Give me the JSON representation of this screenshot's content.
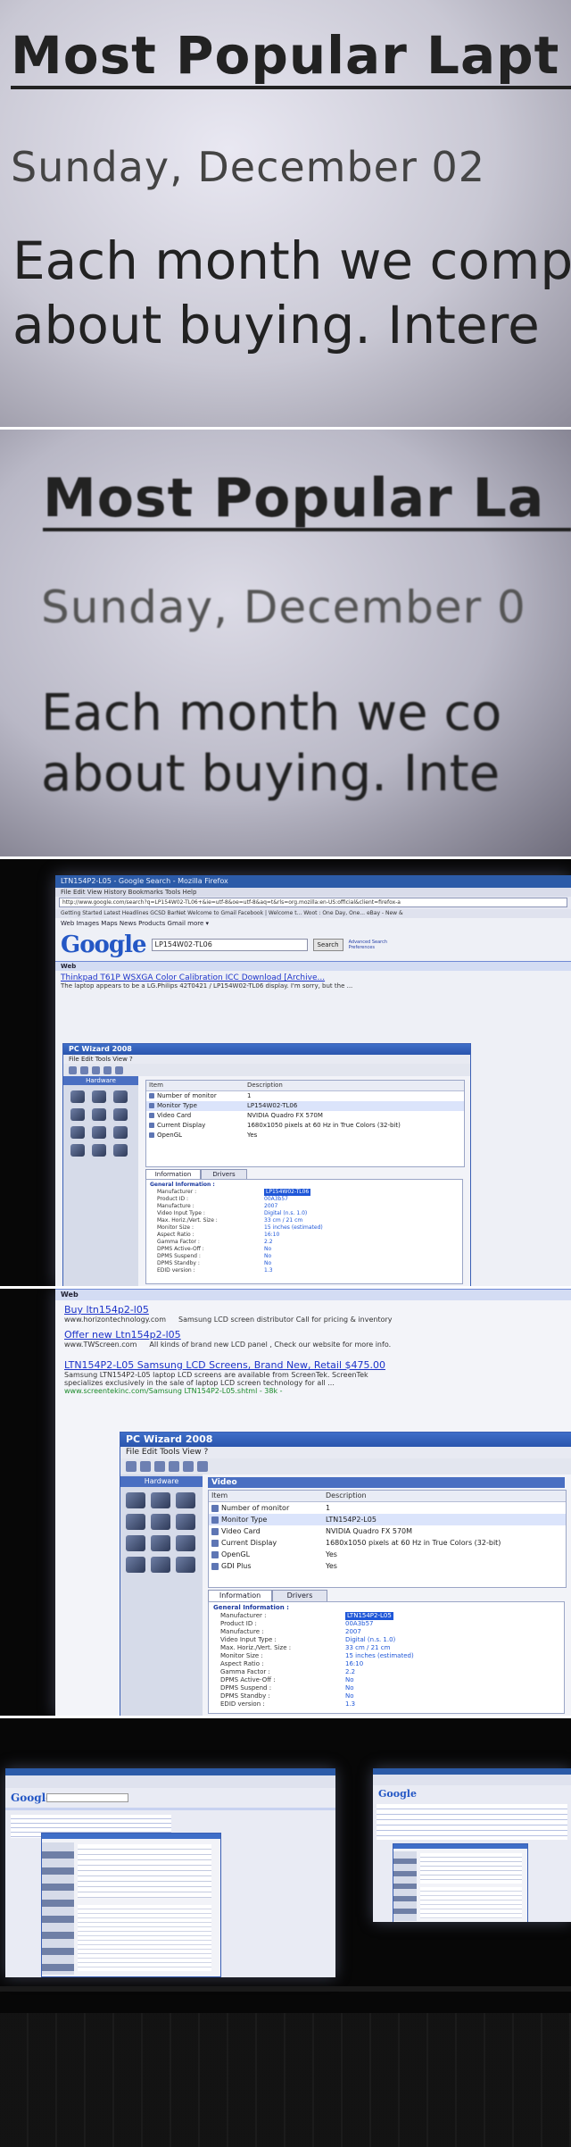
{
  "zoom": {
    "title": "Most Popular Lapt",
    "title_p2": "Most Popular La",
    "date": "Sunday, December 02",
    "date_p2": "Sunday, December 0",
    "body_line1": "Each month we comp",
    "body_line1_p2": "Each month we co",
    "body_line2": "about buying. Intere",
    "body_line2_p2": "about buying. Inte"
  },
  "p3": {
    "window_title": "LTN154P2-L05 - Google Search - Mozilla Firefox",
    "menu": "File   Edit   View   History   Bookmarks   Tools   Help",
    "url": "http://www.google.com/search?q=LP154W02-TL06+&ie=utf-8&oe=utf-8&aq=t&rls=org.mozilla:en-US:official&client=firefox-a",
    "bookmarks": "Getting Started   Latest Headlines   GCSD   BarNet   Welcome to Gmail   Facebook | Welcome t...   Woot : One Day, One...   eBay - New &",
    "nav": "Web   Images   Maps   News   Products   Gmail   more ▾",
    "logo": "Google",
    "query": "LP154W02-TL06",
    "search_btn": "Search",
    "adv_link": "Advanced Search",
    "pref_link": "Preferences",
    "web_label": "Web",
    "result_title": "Thinkpad T61P WSXGA Color Calibration ICC Download [Archive...",
    "result_snip": "The laptop appears to be a LG.Philips 42T0421 / LP154W02-TL06 display. I'm sorry, but the ...",
    "wizard_title": "PC Wizard 2008",
    "wizard_menu": "File   Edit   Tools   View   ?",
    "hardware": "Hardware",
    "col_item": "Item",
    "col_desc": "Description",
    "rows": [
      {
        "item": "Number of monitor",
        "desc": "1"
      },
      {
        "item": "Monitor Type",
        "desc": "LP154W02-TL06"
      },
      {
        "item": "Video Card",
        "desc": "NVIDIA Quadro FX 570M"
      },
      {
        "item": "Current Display",
        "desc": "1680x1050 pixels at 60 Hz in True Colors (32-bit)"
      },
      {
        "item": "OpenGL",
        "desc": "Yes"
      }
    ],
    "tab_info": "Information",
    "tab_drivers": "Drivers",
    "info_head": "General Information :",
    "info": [
      {
        "k": "Manufacturer :",
        "v": "LP154W02-TL06"
      },
      {
        "k": "Product ID :",
        "v": "00A3b57"
      },
      {
        "k": "Manufacture :",
        "v": "2007"
      },
      {
        "k": "Video Input Type :",
        "v": "Digital (n.s. 1.0)"
      },
      {
        "k": "Max. Horiz./Vert. Size :",
        "v": "33 cm / 21 cm"
      },
      {
        "k": "Monitor Size :",
        "v": "15 inches (estimated)"
      },
      {
        "k": "Aspect Ratio :",
        "v": "16:10"
      },
      {
        "k": "Gamma Factor :",
        "v": "2.2"
      },
      {
        "k": "DPMS Active-Off :",
        "v": "No"
      },
      {
        "k": "DPMS Suspend :",
        "v": "No"
      },
      {
        "k": "DPMS Standby :",
        "v": "No"
      },
      {
        "k": "EDID version :",
        "v": "1.3"
      }
    ]
  },
  "p4": {
    "web_label": "Web",
    "ads": [
      {
        "title": "Buy ltn154p2-l05",
        "url": "www.horizontechnology.com",
        "snip": "Samsung LCD screen distributor Call for pricing & inventory"
      },
      {
        "title": "Offer new Ltn154p2-l05",
        "url": "www.TWScreen.com",
        "snip": "All kinds of brand new LCD panel , Check our website for more info."
      }
    ],
    "result_title": "LTN154P2-L05 Samsung LCD Screens, Brand New, Retail $475.00",
    "result_snip1": "Samsung LTN154P2-L05 laptop LCD screens are available from ScreenTek. ScreenTek",
    "result_snip2": "specializes exclusively in the sale of laptop LCD screen technology for all ...",
    "result_url": "www.screentekinc.com/Samsung LTN154P2-L05.shtml - 38k -",
    "wizard_title": "PC Wizard 2008",
    "wizard_menu": "File   Edit   Tools   View   ?",
    "hardware": "Hardware",
    "section": "Video",
    "col_item": "Item",
    "col_desc": "Description",
    "rows": [
      {
        "item": "Number of monitor",
        "desc": "1"
      },
      {
        "item": "Monitor Type",
        "desc": "LTN154P2-L05"
      },
      {
        "item": "Video Card",
        "desc": "NVIDIA Quadro FX 570M"
      },
      {
        "item": "Current Display",
        "desc": "1680x1050 pixels at 60 Hz in True Colors (32-bit)"
      },
      {
        "item": "OpenGL",
        "desc": "Yes"
      },
      {
        "item": "GDI Plus",
        "desc": "Yes"
      }
    ],
    "tab_info": "Information",
    "tab_drivers": "Drivers",
    "info_head": "General Information :",
    "info": [
      {
        "k": "Manufacturer :",
        "v": "LTN154P2-L05"
      },
      {
        "k": "Product ID :",
        "v": "00A3b57"
      },
      {
        "k": "Manufacture :",
        "v": "2007"
      },
      {
        "k": "Video Input Type :",
        "v": "Digital (n.s. 1.0)"
      },
      {
        "k": "Max. Horiz./Vert. Size :",
        "v": "33 cm / 21 cm"
      },
      {
        "k": "Monitor Size :",
        "v": "15 inches (estimated)"
      },
      {
        "k": "Aspect Ratio :",
        "v": "16:10"
      },
      {
        "k": "Gamma Factor :",
        "v": "2.2"
      },
      {
        "k": "DPMS Active-Off :",
        "v": "No"
      },
      {
        "k": "DPMS Suspend :",
        "v": "No"
      },
      {
        "k": "DPMS Standby :",
        "v": "No"
      },
      {
        "k": "EDID version :",
        "v": "1.3"
      }
    ]
  },
  "p5": {
    "logo_left": "Google",
    "logo_right": "Google"
  },
  "colors": {
    "google_blue": "#2457c5",
    "link_blue": "#1c33c9",
    "wizard_blue": "#3f6ec8",
    "url_green": "#1a8a2a"
  }
}
